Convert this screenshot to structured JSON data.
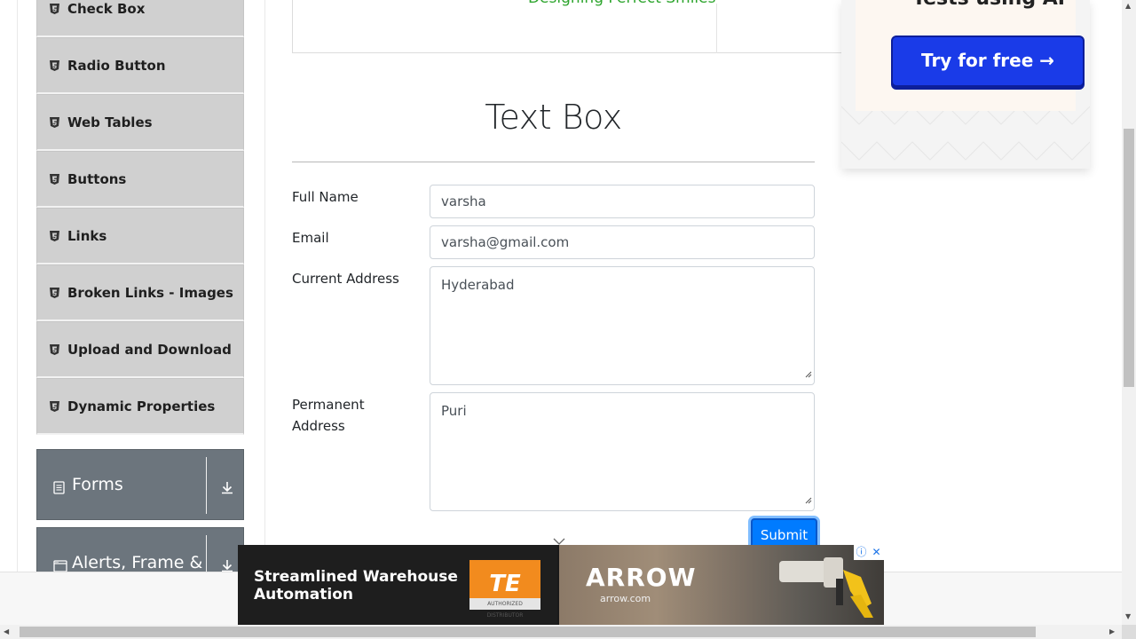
{
  "sidebar": {
    "items": [
      {
        "label": "Check Box"
      },
      {
        "label": "Radio Button"
      },
      {
        "label": "Web Tables"
      },
      {
        "label": "Buttons"
      },
      {
        "label": "Links"
      },
      {
        "label": "Broken Links - Images"
      },
      {
        "label": "Upload and Download"
      },
      {
        "label": "Dynamic Properties"
      }
    ],
    "groups": [
      {
        "label": "Forms",
        "icon": "document-icon"
      },
      {
        "label": "Alerts, Frame &",
        "icon": "window-icon"
      }
    ]
  },
  "top_ad": {
    "text": "Designing Perfect Smiles"
  },
  "form": {
    "title": "Text Box",
    "full_name": {
      "label": "Full Name",
      "value": "varsha"
    },
    "email": {
      "label": "Email",
      "value": "varsha@gmail.com"
    },
    "current_address": {
      "label": "Current Address",
      "value": "Hyderabad"
    },
    "permanent_address": {
      "label_line1": "Permanent",
      "label_line2": "Address",
      "value": "Puri"
    },
    "submit_label": "Submit"
  },
  "right_ad": {
    "headline": "Tests using AI",
    "cta": "Try for free →"
  },
  "bottom_ad": {
    "line1": "Streamlined Warehouse",
    "line2": "Automation",
    "logo_text": "TE",
    "logo_sub": "AUTHORIZED DISTRIBUTOR",
    "brand": "ARROW",
    "url": "arrow.com"
  },
  "colors": {
    "sidebar_item": "#d0d0d0",
    "group_header": "#6c757d",
    "primary": "#007bff",
    "ad_button": "#1a3be8"
  }
}
